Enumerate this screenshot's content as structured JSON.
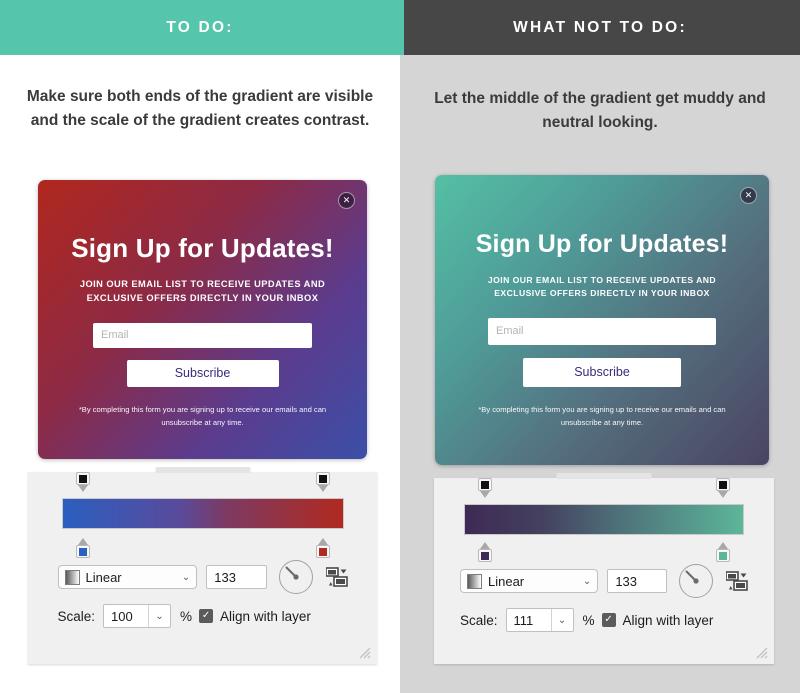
{
  "left": {
    "header": "TO DO:",
    "header_color": "#55c6ab",
    "caption": "Make sure both ends of the gradient are visible and the scale of the gradient creates contrast.",
    "modal": {
      "title": "Sign Up for Updates!",
      "subtitle": "JOIN OUR EMAIL LIST TO RECEIVE UPDATES AND EXCLUSIVE OFFERS DIRECTLY IN YOUR INBOX",
      "email_placeholder": "Email",
      "email_value": "",
      "subscribe_label": "Subscribe",
      "disclaimer": "*By completing this form you are signing up to receive our emails and can unsubscribe at any time.",
      "close_icon": "close-icon",
      "gradient_start": "#b1271d",
      "gradient_end": "#3b4fa8",
      "gradient_angle": "133deg"
    },
    "editor": {
      "gradient_start": "#2b5fc0",
      "gradient_end": "#b02a1f",
      "opacity_stop_left": "#111111",
      "opacity_stop_right": "#111111",
      "color_stop_left": "#2b5fc0",
      "color_stop_right": "#b02a1f",
      "style_label": "Linear",
      "angle_value": "133",
      "scale_label": "Scale:",
      "scale_value": "100",
      "percent_symbol": "%",
      "align_label": "Align with layer",
      "align_checked": "✓",
      "chevron": "⌄"
    }
  },
  "right": {
    "header": "WHAT NOT TO DO:",
    "header_color": "#474747",
    "caption": "Let the middle of the gradient get muddy and neutral looking.",
    "modal": {
      "title": "Sign Up for Updates!",
      "subtitle": "JOIN OUR EMAIL LIST TO RECEIVE UPDATES AND EXCLUSIVE OFFERS DIRECTLY IN YOUR INBOX",
      "email_placeholder": "Email",
      "email_value": "",
      "subscribe_label": "Subscribe",
      "disclaimer": "*By completing this form you are signing up to receive our emails and can unsubscribe at any time.",
      "close_icon": "close-icon",
      "gradient_start": "#54c0a4",
      "gradient_end": "#4a4461",
      "gradient_angle": "133deg"
    },
    "editor": {
      "gradient_start": "#3e2a55",
      "gradient_end": "#5cb699",
      "opacity_stop_left": "#111111",
      "opacity_stop_right": "#111111",
      "color_stop_left": "#3e2a55",
      "color_stop_right": "#5cb699",
      "style_label": "Linear",
      "angle_value": "133",
      "scale_label": "Scale:",
      "scale_value": "111",
      "percent_symbol": "%",
      "align_label": "Align with layer",
      "align_checked": "✓",
      "chevron": "⌄"
    }
  }
}
